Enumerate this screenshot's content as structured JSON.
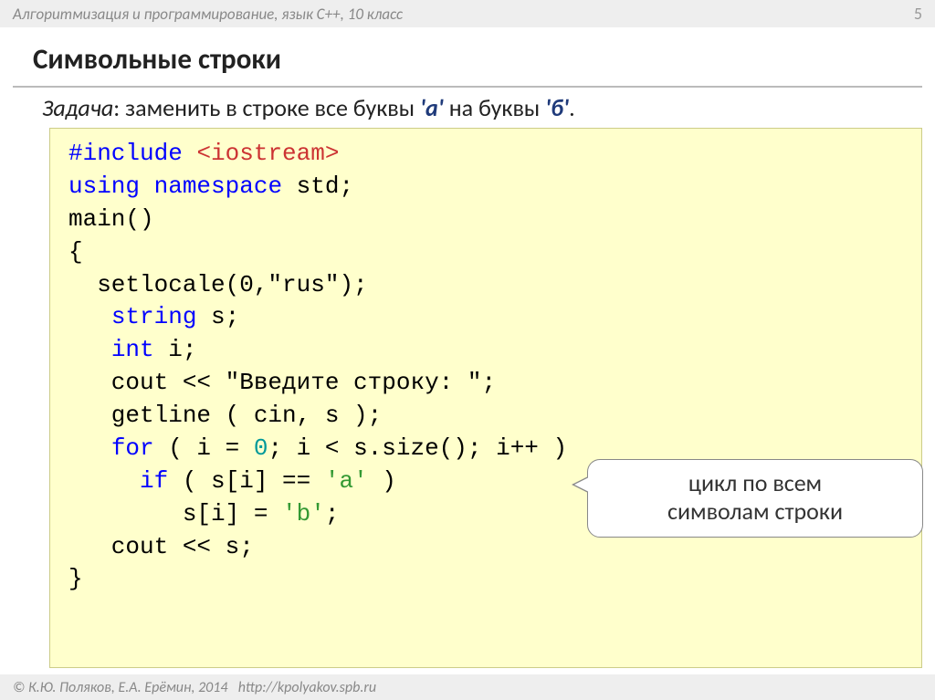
{
  "header": {
    "breadcrumb": "Алгоритмизация и программирование, язык C++, 10 класс",
    "page_number": "5"
  },
  "title": "Символьные строки",
  "task": {
    "label": "Задача",
    "body": ": заменить в строке все буквы ",
    "char_a": "'а'",
    "mid": " на буквы ",
    "char_b": "'б'",
    "tail": "."
  },
  "code": {
    "l1_a": "#include ",
    "l1_b": "<iostream>",
    "l2_a": "using",
    "l2_b": " ",
    "l2_c": "namespace",
    "l2_d": " std;",
    "l3": "main()",
    "l4": "{",
    "l5": "  setlocale(0,\"rus\");",
    "l6_a": "   ",
    "l6_b": "string",
    "l6_c": " s;",
    "l7_a": "   ",
    "l7_b": "int",
    "l7_c": " i;",
    "l8": "   cout << \"Введите строку: \";",
    "l9": "   getline ( cin, s );",
    "l10_a": "   ",
    "l10_b": "for",
    "l10_c": " ( i = ",
    "l10_d": "0",
    "l10_e": "; i < s.size(); i++ )",
    "l11_a": "     ",
    "l11_b": "if",
    "l11_c": " ( s[i] == ",
    "l11_d": "'а'",
    "l11_e": " )",
    "l12_a": "        s[i] = ",
    "l12_b": "'b'",
    "l12_c": ";",
    "l13": "   cout << s;",
    "l14": "}"
  },
  "callout": {
    "line1": "цикл по всем",
    "line2": "символам строки"
  },
  "footer": {
    "copyright": "© К.Ю. Поляков, Е.А. Ерёмин, 2014",
    "url": "http://kpolyakov.spb.ru"
  }
}
